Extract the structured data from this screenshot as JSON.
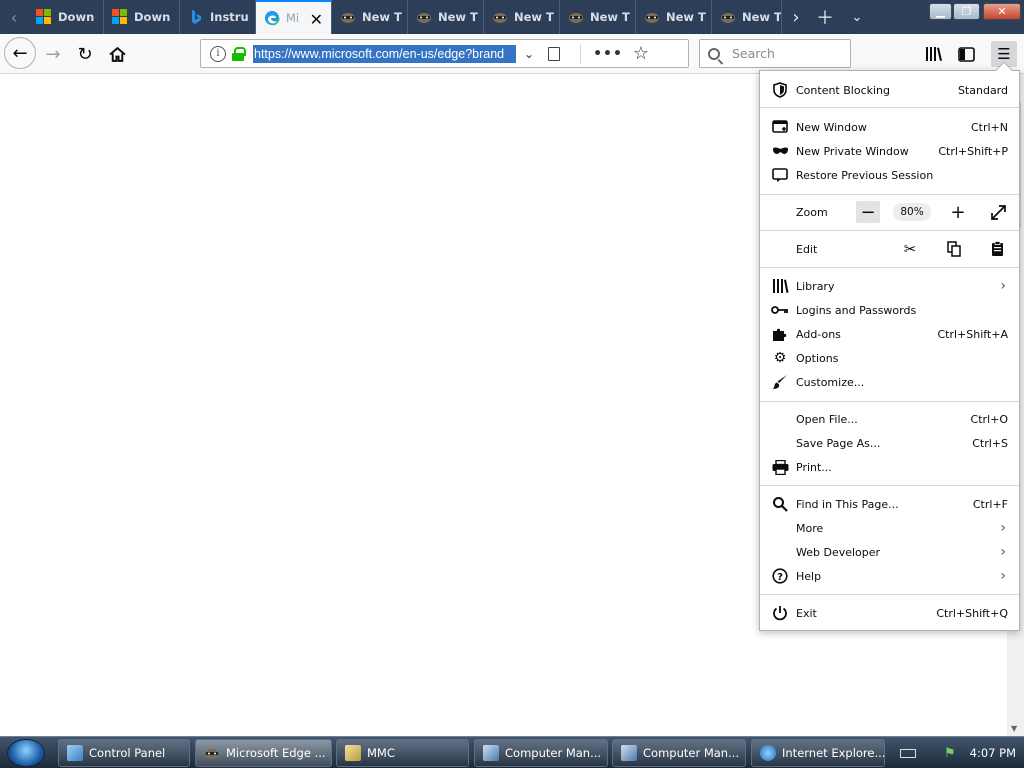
{
  "tabs": [
    {
      "title": "Down",
      "icon": "microsoft-logo-icon"
    },
    {
      "title": "Down",
      "icon": "microsoft-logo-icon"
    },
    {
      "title": "Instru",
      "icon": "bing-icon"
    },
    {
      "title": "Mi",
      "icon": "edge-icon",
      "selected": true
    },
    {
      "title": "New T",
      "icon": "raccoon-icon"
    },
    {
      "title": "New T",
      "icon": "raccoon-icon"
    },
    {
      "title": "New T",
      "icon": "raccoon-icon"
    },
    {
      "title": "New T",
      "icon": "raccoon-icon"
    },
    {
      "title": "New T",
      "icon": "raccoon-icon"
    },
    {
      "title": "New T",
      "icon": "raccoon-icon"
    }
  ],
  "navbar": {
    "url": "https://www.microsoft.com/en-us/edge?brand",
    "search_placeholder": "Search"
  },
  "menu": {
    "content_blocking": {
      "label": "Content Blocking",
      "value": "Standard"
    },
    "new_window": {
      "label": "New Window",
      "shortcut": "Ctrl+N"
    },
    "new_private_window": {
      "label": "New Private Window",
      "shortcut": "Ctrl+Shift+P"
    },
    "restore_session": {
      "label": "Restore Previous Session"
    },
    "zoom": {
      "label": "Zoom",
      "level": "80%"
    },
    "edit": {
      "label": "Edit"
    },
    "library": {
      "label": "Library"
    },
    "logins": {
      "label": "Logins and Passwords"
    },
    "addons": {
      "label": "Add-ons",
      "shortcut": "Ctrl+Shift+A"
    },
    "options": {
      "label": "Options"
    },
    "customize": {
      "label": "Customize..."
    },
    "open_file": {
      "label": "Open File...",
      "shortcut": "Ctrl+O"
    },
    "save_page": {
      "label": "Save Page As...",
      "shortcut": "Ctrl+S"
    },
    "print": {
      "label": "Print..."
    },
    "find": {
      "label": "Find in This Page...",
      "shortcut": "Ctrl+F"
    },
    "more": {
      "label": "More"
    },
    "web_developer": {
      "label": "Web Developer"
    },
    "help": {
      "label": "Help"
    },
    "exit": {
      "label": "Exit",
      "shortcut": "Ctrl+Shift+Q"
    }
  },
  "taskbar": {
    "items": [
      {
        "label": "Control Panel",
        "icon": "control-panel-icon"
      },
      {
        "label": "Microsoft Edge ...",
        "icon": "raccoon-icon",
        "active": true
      },
      {
        "label": "MMC",
        "icon": "mmc-icon"
      },
      {
        "label": "Computer Man...",
        "icon": "computer-management-icon"
      },
      {
        "label": "Computer Man...",
        "icon": "computer-management-icon"
      },
      {
        "label": "Internet Explore...",
        "icon": "internet-explorer-icon"
      }
    ],
    "clock": "4:07 PM"
  }
}
